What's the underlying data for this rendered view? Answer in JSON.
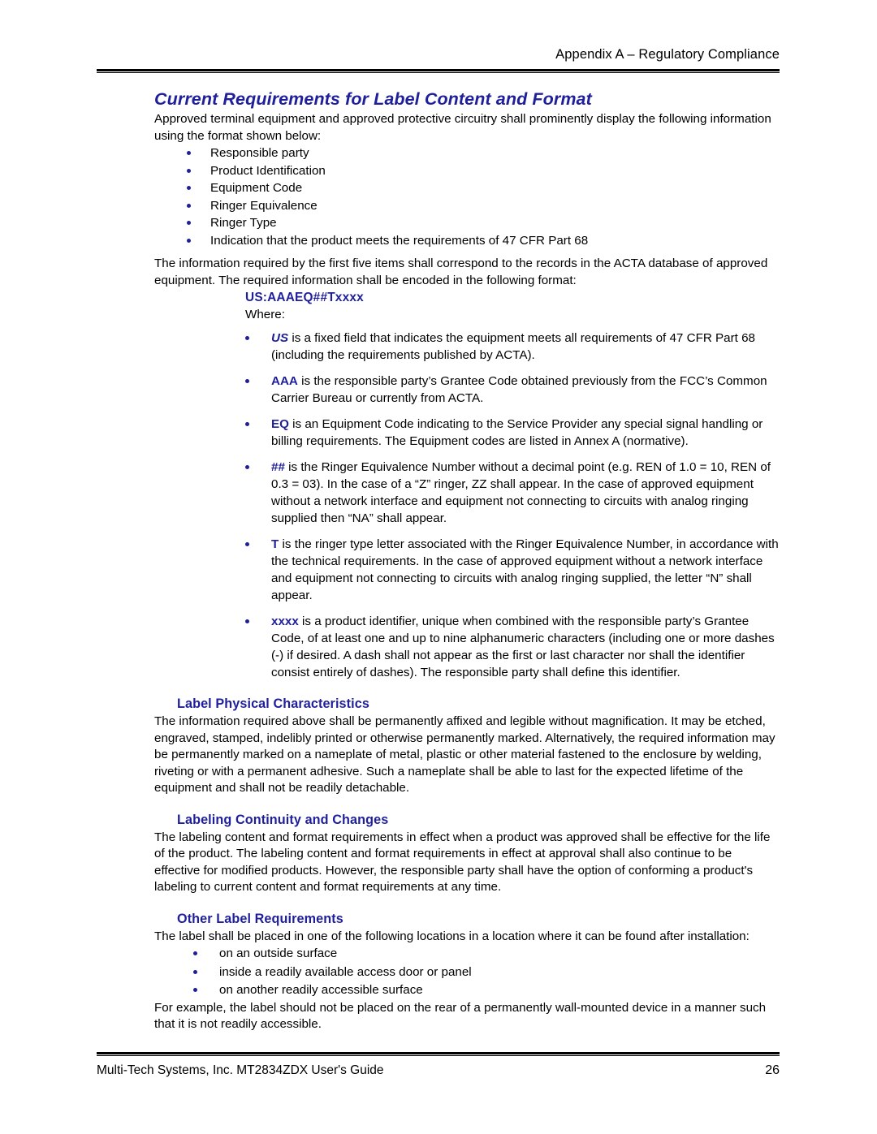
{
  "header": {
    "running_head": "Appendix A – Regulatory Compliance"
  },
  "main": {
    "title": "Current Requirements for Label Content and Format",
    "intro_paragraph": "Approved terminal equipment and approved protective circuitry shall prominently display the following information using the format shown below:",
    "requirement_items": [
      "Responsible party",
      "Product Identification",
      "Equipment Code",
      "Ringer Equivalence",
      "Ringer Type",
      "Indication that the product meets the requirements of 47 CFR Part 68"
    ],
    "acta_paragraph": "The information required by the first five items shall correspond to the records in the ACTA database of approved equipment. The required information shall be encoded in the following format:",
    "format_code": "US:AAAEQ##Txxxx",
    "where_label": "Where:",
    "format_definitions": [
      {
        "term": "US",
        "term_style": "bold-italic",
        "text": " is a fixed field that indicates the equipment meets all requirements of 47 CFR Part 68 (including the requirements published by ACTA)."
      },
      {
        "term": "AAA",
        "term_style": "bold",
        "text": " is the responsible party’s Grantee Code obtained previously from the FCC’s Common Carrier Bureau or currently from ACTA."
      },
      {
        "term": "EQ",
        "term_style": "bold",
        "text": " is an Equipment Code indicating to the Service Provider any special signal handling or billing requirements. The Equipment codes are listed in Annex A (normative)."
      },
      {
        "term": "##",
        "term_style": "bold",
        "text": " is the Ringer Equivalence Number without a decimal point (e.g. REN of 1.0 = 10, REN of 0.3 = 03). In the case of a “Z” ringer, ZZ shall appear. In the case of approved equipment without a network interface and equipment not connecting to circuits with analog ringing supplied then “NA” shall appear."
      },
      {
        "term": "T",
        "term_style": "bold",
        "text": " is the ringer type letter associated with the Ringer Equivalence Number, in accordance with the technical requirements. In the case of approved equipment without a network interface and equipment not connecting to circuits with analog ringing supplied, the letter “N” shall appear."
      },
      {
        "term": "xxxx",
        "term_style": "bold",
        "text": " is a product identifier, unique when combined with the responsible party’s Grantee Code, of at least one and up to nine alphanumeric characters (including one or more dashes (-) if desired. A dash shall not appear as the first or last character nor shall the identifier consist entirely of dashes). The responsible party shall define this identifier."
      }
    ],
    "sections": [
      {
        "heading": "Label Physical Characteristics",
        "paragraph": "The information required above shall be permanently affixed and legible without magnification. It may be etched, engraved, stamped, indelibly printed or otherwise permanently marked. Alternatively, the required information may be permanently marked on a nameplate of metal, plastic or other material fastened to the enclosure by welding, riveting or with a permanent adhesive. Such a nameplate shall be able to last for the expected lifetime of the equipment and shall not be readily detachable."
      },
      {
        "heading": "Labeling Continuity and Changes",
        "paragraph": "The labeling content and format requirements in effect when a product was approved shall be effective for the life of the product. The labeling content and format requirements in effect at approval shall also continue to be effective for modified products. However, the responsible party shall have the option of conforming a product's labeling to current content and format requirements at any time."
      }
    ],
    "other_label_requirements": {
      "heading": "Other Label Requirements",
      "intro": "The label shall be placed in one of the following locations in a location where it can be found after installation:",
      "locations": [
        "on an outside surface",
        "inside a readily available access door or panel",
        "on another readily accessible surface"
      ],
      "closing": "For example, the label should not be placed on the rear of a permanently wall-mounted device in a manner such that it is not readily accessible."
    }
  },
  "footer": {
    "source": "Multi-Tech Systems, Inc. MT2834ZDX User's Guide",
    "page_number": "26"
  },
  "colors": {
    "heading_blue": "#1f1f9c",
    "body_black": "#000000",
    "page_background": "#ffffff"
  }
}
